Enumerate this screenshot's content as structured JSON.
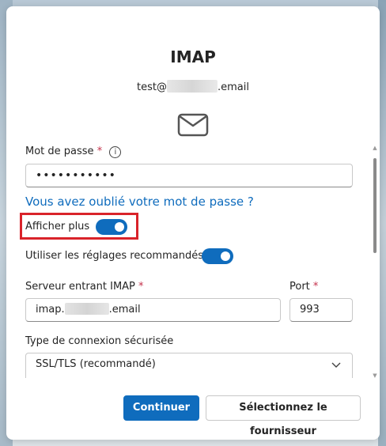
{
  "dialog": {
    "title": "IMAP",
    "email": {
      "prefix": "test@",
      "suffix": ".email"
    },
    "icon": "mail-envelope-icon",
    "password": {
      "label": "Mot de passe",
      "required_mark": "*",
      "info_icon": "info-icon",
      "value": "•••••••••••"
    },
    "forgot_link": "Vous avez oublié votre mot de passe ?",
    "show_more": {
      "label": "Afficher plus",
      "on": true
    },
    "recommended": {
      "label": "Utiliser les réglages recommandés",
      "on": true
    },
    "incoming_server": {
      "label": "Serveur entrant IMAP",
      "required_mark": "*",
      "prefix": "imap.",
      "suffix": ".email"
    },
    "port": {
      "label": "Port",
      "required_mark": "*",
      "value": "993"
    },
    "connection_type": {
      "label": "Type de connexion sécurisée",
      "value": "SSL/TLS (recommandé)"
    },
    "buttons": {
      "continue": "Continuer",
      "select_provider": "Sélectionnez le fournisseur"
    },
    "colors": {
      "accent": "#0f6cbd",
      "highlight": "#d9232a",
      "required": "#c4314b"
    }
  }
}
